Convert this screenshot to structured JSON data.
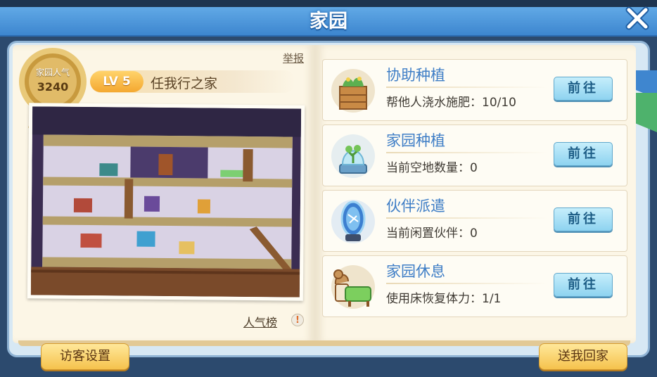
{
  "window": {
    "title": "家园"
  },
  "home": {
    "popularity_label": "家园人气",
    "popularity_value": "3240",
    "level": "LV 5",
    "name": "任我行之家",
    "report_label": "举报",
    "ranking_label": "人气榜",
    "info_symbol": "!"
  },
  "tasks": [
    {
      "title": "协助种植",
      "desc": "帮他人浇水施肥：10/10",
      "button": "前往",
      "icon": "planter-box-icon"
    },
    {
      "title": "家园种植",
      "desc": "当前空地数量：0",
      "button": "前往",
      "icon": "plant-capsule-icon"
    },
    {
      "title": "伙伴派遣",
      "desc": "当前闲置伙伴：0",
      "button": "前往",
      "icon": "portal-mirror-icon"
    },
    {
      "title": "家园休息",
      "desc": "使用床恢复体力：1/1",
      "button": "前往",
      "icon": "bed-icon"
    }
  ],
  "footer": {
    "visitor_settings": "访客设置",
    "send_home": "送我回家"
  },
  "colors": {
    "accent_blue": "#3f7ec6",
    "button_blue": "#8ed3f0",
    "button_gold": "#f5c24d",
    "paper": "#fcf6e6"
  }
}
